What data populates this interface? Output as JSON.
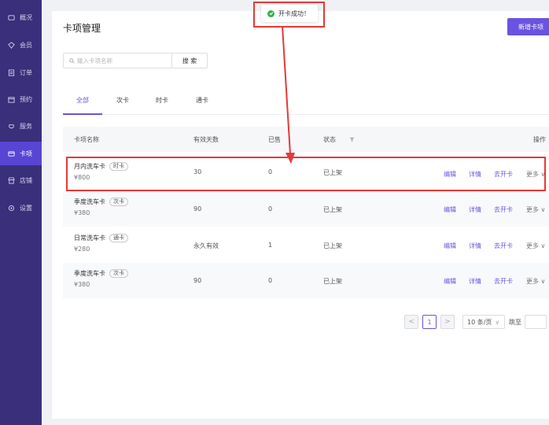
{
  "sidebar": {
    "items": [
      {
        "label": "概况",
        "icon": "overview-icon"
      },
      {
        "label": "会员",
        "icon": "member-icon"
      },
      {
        "label": "订单",
        "icon": "order-icon"
      },
      {
        "label": "预约",
        "icon": "booking-icon"
      },
      {
        "label": "服务",
        "icon": "service-icon"
      },
      {
        "label": "卡项",
        "icon": "card-icon",
        "active": true
      },
      {
        "label": "店铺",
        "icon": "store-icon"
      },
      {
        "label": "设置",
        "icon": "settings-icon"
      }
    ]
  },
  "header": {
    "title": "卡项管理",
    "new_button": "新增卡项"
  },
  "toast": {
    "text": "开卡成功！"
  },
  "search": {
    "placeholder": "输入卡项名称",
    "button": "搜 索"
  },
  "tabs": [
    {
      "label": "全部",
      "active": true
    },
    {
      "label": "次卡"
    },
    {
      "label": "时卡"
    },
    {
      "label": "通卡"
    }
  ],
  "table": {
    "headers": {
      "name": "卡项名称",
      "days": "有效天数",
      "sold": "已售",
      "status": "状态",
      "actions": "操作"
    },
    "rows": [
      {
        "name": "月内洗车卡",
        "tag": "时卡",
        "price": "¥800",
        "days": "30",
        "sold": "0",
        "status": "已上架"
      },
      {
        "name": "季度洗车卡",
        "tag": "次卡",
        "price": "¥380",
        "days": "90",
        "sold": "0",
        "status": "已上架"
      },
      {
        "name": "日常洗车卡",
        "tag": "通卡",
        "price": "¥280",
        "days": "永久有效",
        "sold": "1",
        "status": "已上架"
      },
      {
        "name": "季度洗车卡",
        "tag": "次卡",
        "price": "¥380",
        "days": "90",
        "sold": "0",
        "status": "已上架"
      }
    ],
    "row_actions": {
      "edit": "编辑",
      "detail": "详情",
      "open_card": "去开卡",
      "more": "更多"
    }
  },
  "pagination": {
    "prev": "<",
    "current_page": "1",
    "next": ">",
    "page_size": "10 条/页",
    "jump_label": "跳至"
  },
  "colors": {
    "accent": "#6a53e0",
    "sidebar": "#3a2f7a",
    "highlight": "#e53935",
    "success": "#3cb34a"
  }
}
